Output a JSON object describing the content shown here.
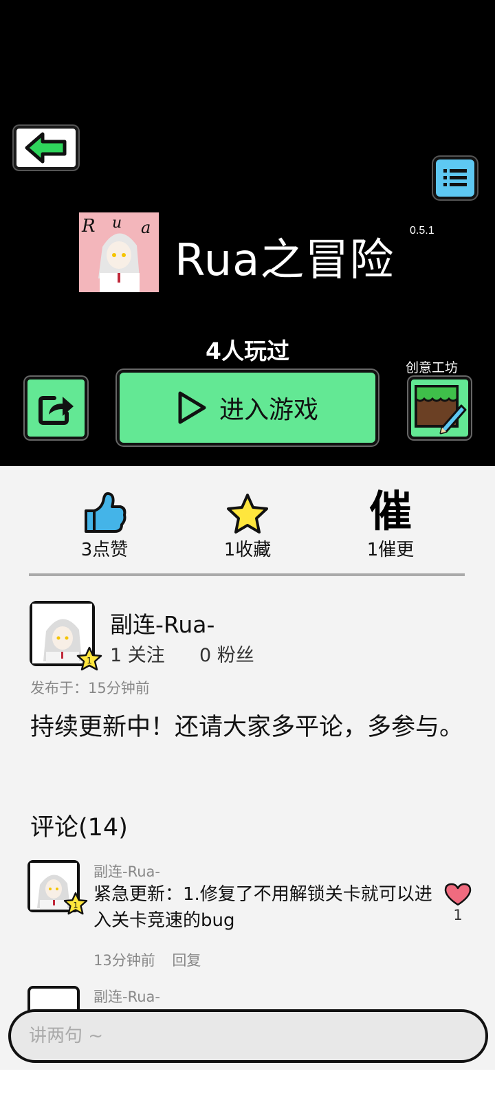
{
  "header": {
    "back_icon": "arrow-left-icon",
    "menu_icon": "list-icon"
  },
  "game": {
    "title": "Rua之冒险",
    "version": "0.5.1",
    "icon_text": "Rua",
    "played": "4人玩过"
  },
  "actions": {
    "play_label": "进入游戏",
    "workshop_label": "创意工坊",
    "share_icon": "share-icon",
    "play_icon": "play-icon",
    "workshop_icon": "edit-icon"
  },
  "stats": {
    "likes": "3点赞",
    "favorites": "1收藏",
    "urge": "1催更",
    "urge_glyph": "催"
  },
  "author": {
    "name": "副连-Rua-",
    "follow": "1 关注",
    "fans": "0 粉丝",
    "level": "1",
    "posted": "发布于：15分钟前"
  },
  "description": "持续更新中！还请大家多平论，多参与。",
  "comments": {
    "title": "评论(14)",
    "items": [
      {
        "author": "副连-Rua-",
        "text": "紧急更新：1.修复了不用解锁关卡就可以进入关卡竞速的bug",
        "time": "13分钟前",
        "reply": "回复",
        "likes": "1",
        "level": "1"
      },
      {
        "author": "副连-Rua-"
      }
    ]
  },
  "input": {
    "placeholder": "讲两句 ~"
  },
  "colors": {
    "green": "#63e894",
    "blue": "#5ec8f2",
    "pink": "#f3b6bb",
    "heart": "#f06b7f",
    "star": "#ffe63d"
  }
}
